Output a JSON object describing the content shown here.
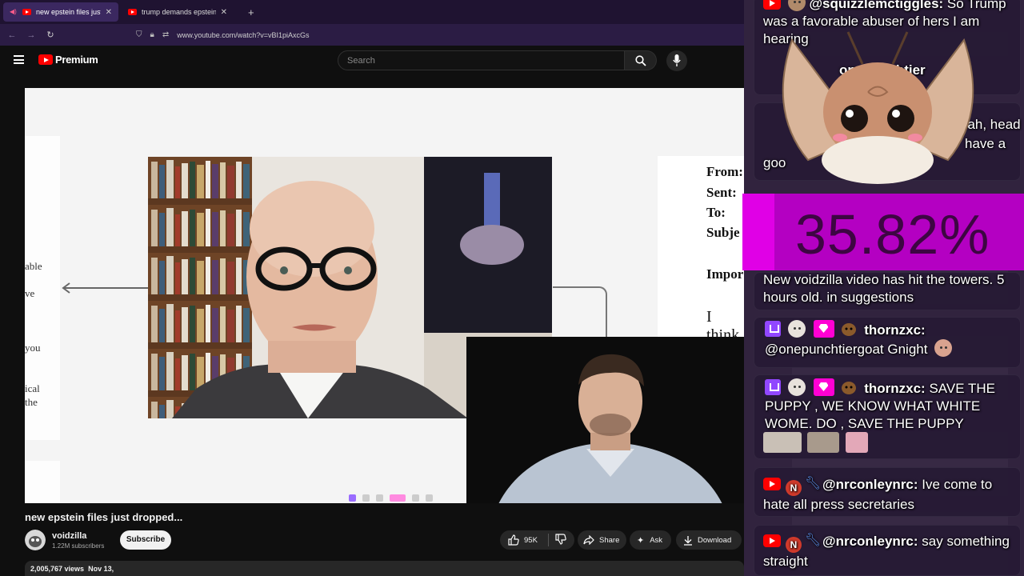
{
  "browser": {
    "tabs": [
      {
        "title": "new epstein files just dropped...",
        "active": true
      },
      {
        "title": "trump demands epstein investi",
        "active": false
      }
    ],
    "new_tab": "+",
    "url": "www.youtube.com/watch?v=vBI1piAxcGs"
  },
  "youtube": {
    "logo_text": "Premium",
    "search_placeholder": "Search"
  },
  "video": {
    "doc_left_lines": [
      "able",
      "ve",
      "you",
      "ical",
      "the"
    ],
    "doc_right_labels": [
      "From:",
      "Sent:",
      "To:",
      "Subje",
      "Impor"
    ],
    "doc_right_body": "I think"
  },
  "meta": {
    "title": "new epstein files just dropped...",
    "channel": "voidzilla",
    "subscribers": "1.22M subscribers",
    "subscribe_label": "Subscribe",
    "likes": "95K",
    "share_label": "Share",
    "ask_label": "Ask",
    "download_label": "Download",
    "views": "2,005,767 views",
    "date": "Nov 13,"
  },
  "overlay": {
    "percent": "35.82%",
    "messages": [
      {
        "user": "@squizzlemctiggles:",
        "text": "So Trump was a favorable abuser of hers I am hearing"
      },
      {
        "user": "onepunchtier",
        "text": "eah, head",
        "text2": "have a",
        "text3": "goo"
      },
      {
        "user": "",
        "text": "New voidzilla video has hit the towers. 5 hours old. in suggestions"
      },
      {
        "user": "thornzxc:",
        "text": "@onepunchtiergoat Gnight"
      },
      {
        "user": "thornzxc:",
        "text": "SAVE THE PUPPY , WE KNOW WHAT WHITE WOME. DO , SAVE THE PUPPY"
      },
      {
        "user": "@nrconleynrc:",
        "text": "Ive come to hate all press secretaries"
      },
      {
        "user": "@nrconleynrc:",
        "text": "say something straight"
      }
    ],
    "badge_n": "N"
  },
  "colors": {
    "accent_red": "#ff0000",
    "overlay_magenta": "#e000e6",
    "browser_purple": "#1f1331"
  }
}
